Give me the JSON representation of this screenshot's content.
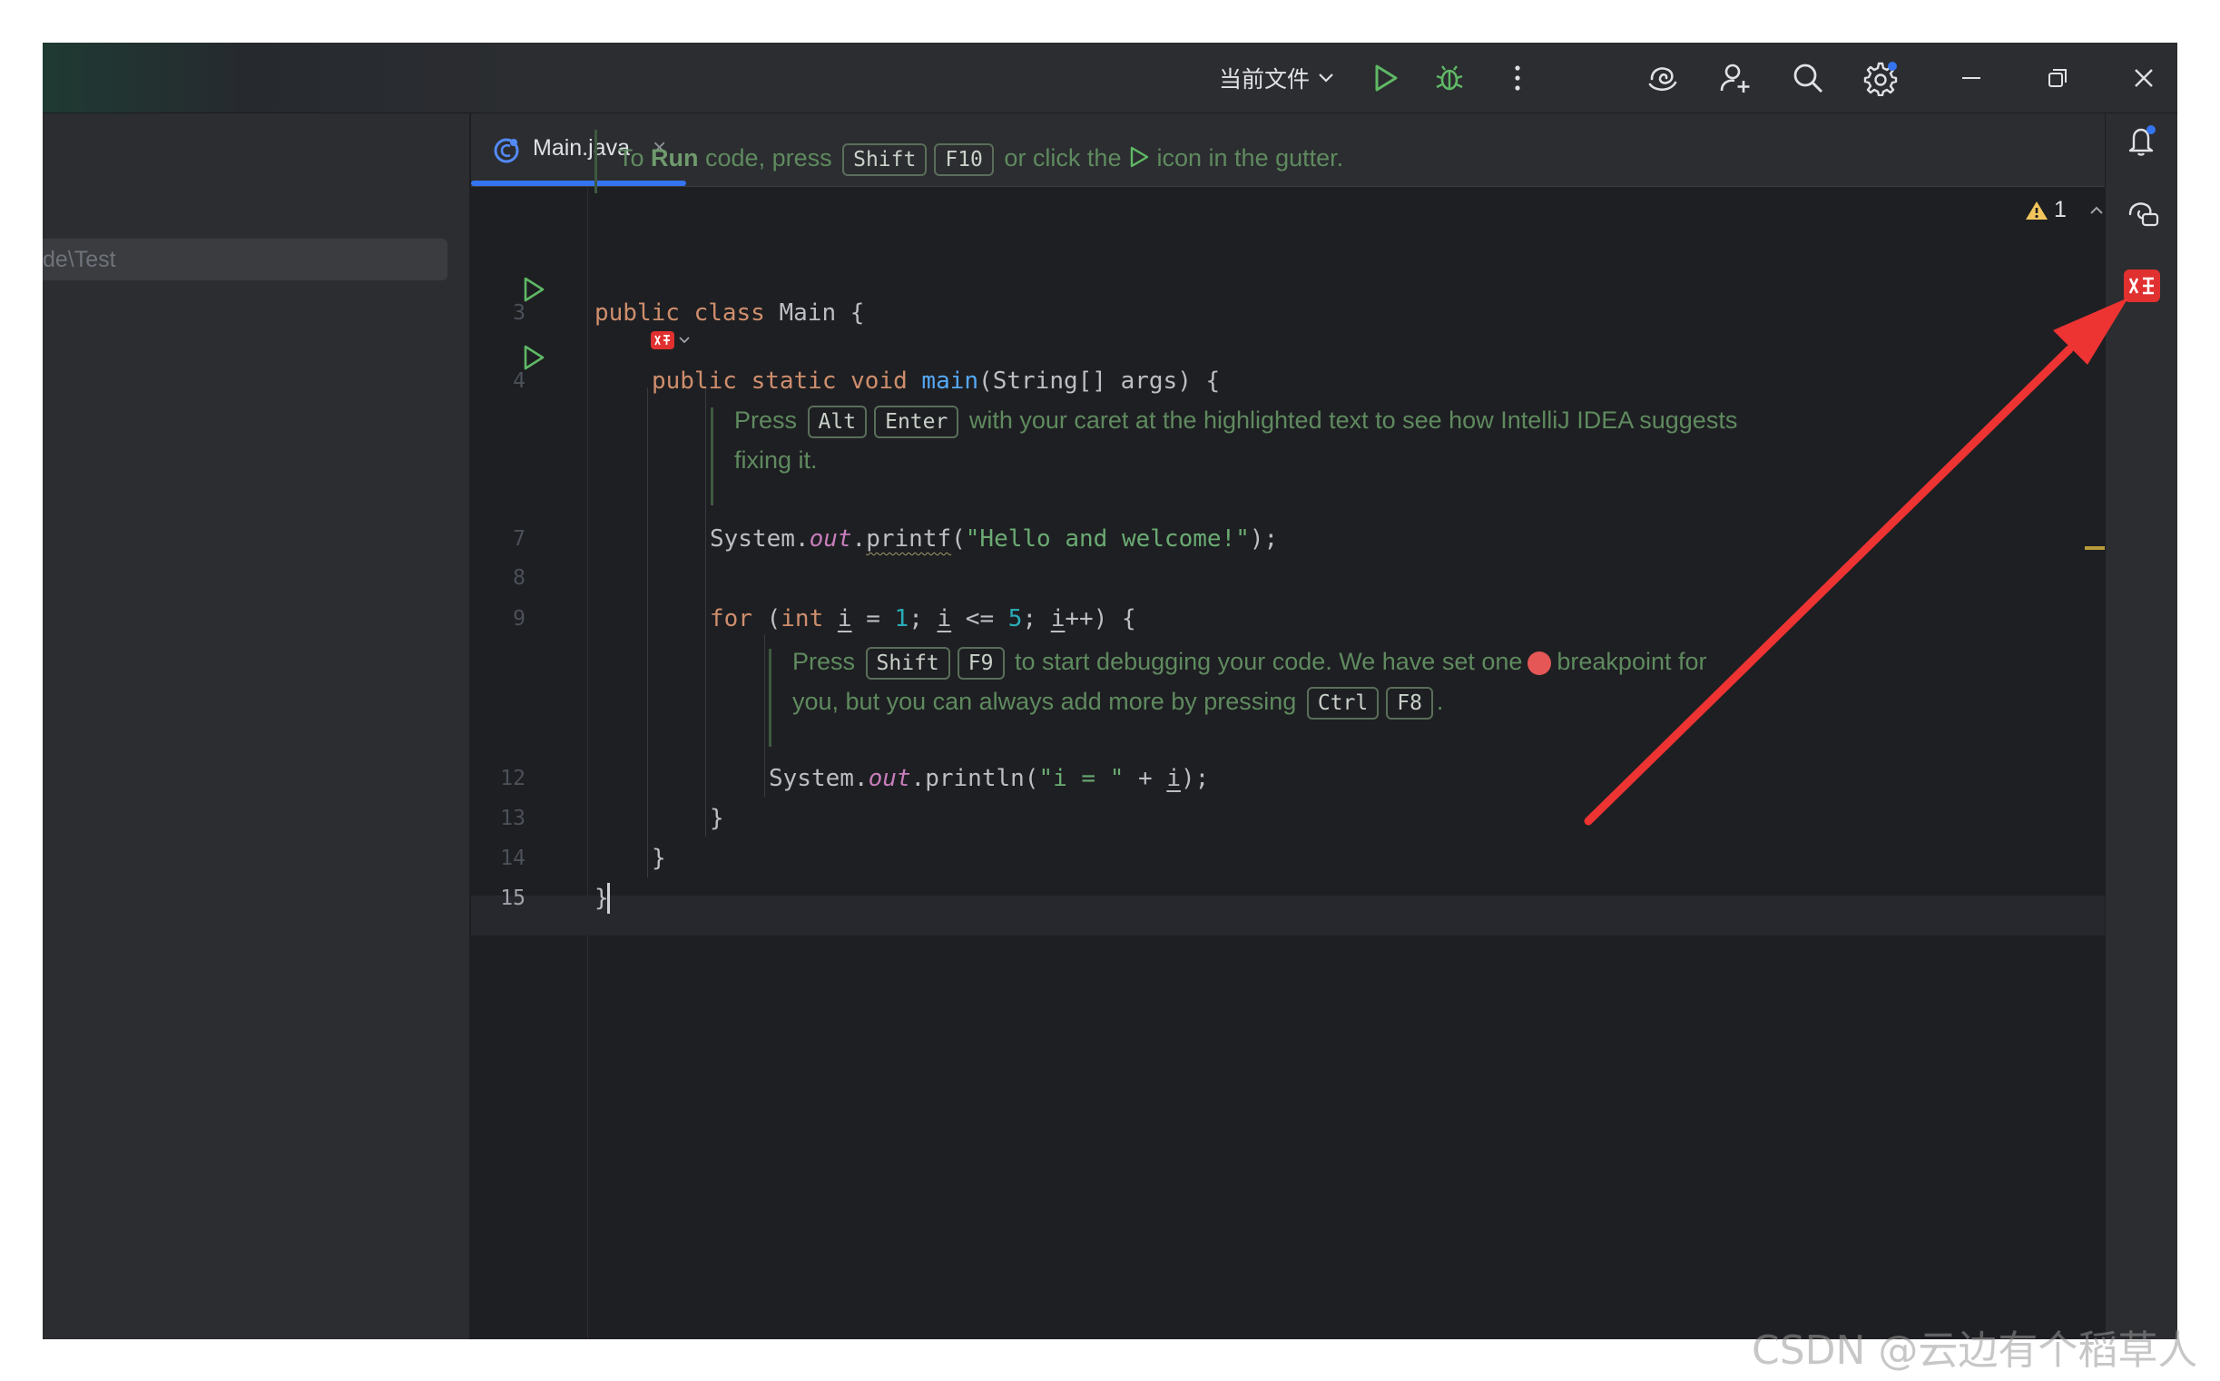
{
  "titlebar": {
    "run_config": "当前文件",
    "icons": [
      "run-icon",
      "debug-icon",
      "more-icon",
      "ai-assistant-icon",
      "add-user-icon",
      "search-icon",
      "settings-icon",
      "minimize-icon",
      "restore-icon",
      "close-icon"
    ]
  },
  "project": {
    "path": "de\\Test"
  },
  "editor": {
    "tab_label": "Main.java",
    "tab_close": "×",
    "warning_count": "1",
    "line_numbers": {
      "l3": "3",
      "l4": "4",
      "l7": "7",
      "l8": "8",
      "l9": "9",
      "l12": "12",
      "l13": "13",
      "l14": "14",
      "l15": "15"
    },
    "hints": {
      "run_prefix": "To ",
      "run_bold": "Run",
      "run_mid": " code, press",
      "run_key1": "Shift",
      "run_key2": "F10",
      "run_mid2": "or click the",
      "run_suffix": "icon in the gutter.",
      "alt_prefix": "Press",
      "alt_key1": "Alt",
      "alt_key2": "Enter",
      "alt_suffix": "with your caret at the highlighted text to see how IntelliJ IDEA suggests",
      "alt_line2": "fixing it.",
      "debug_prefix": "Press",
      "debug_key1": "Shift",
      "debug_key2": "F9",
      "debug_mid": "to start debugging your code. We have set one",
      "debug_suffix": "breakpoint for",
      "debug_line2": "you, but you can always add more by pressing",
      "debug_key3": "Ctrl",
      "debug_key4": "F8",
      "debug_end": "."
    },
    "code": {
      "l3_kw": "public class",
      "l3_rest": " Main {",
      "l4_kw": "public static void",
      "l4_fn": "main",
      "l4_rest": "(String[] args) {",
      "l7_a": "System.",
      "l7_field": "out",
      "l7_dot": ".",
      "l7_fn": "printf",
      "l7_paren": "(",
      "l7_str": "\"Hello and welcome!\"",
      "l7_end": ");",
      "l9_kw": "for",
      "l9_a": " (",
      "l9_int": "int",
      "l9_i1": "i",
      "l9_b": " = ",
      "l9_n1": "1",
      "l9_c": "; ",
      "l9_i2": "i",
      "l9_d": " <= ",
      "l9_n2": "5",
      "l9_e": "; ",
      "l9_i3": "i",
      "l9_f": "++) {",
      "l12_a": "System.",
      "l12_field": "out",
      "l12_b": ".println(",
      "l12_str": "\"i = \"",
      "l12_c": " + ",
      "l12_i": "i",
      "l12_d": ");",
      "l13": "}",
      "l14": "}",
      "l15": "}"
    }
  },
  "right_toolbar": {
    "icons": [
      "notifications-icon",
      "ai-chat-icon",
      "translate-plugin-icon"
    ]
  },
  "colors": {
    "accent": "#3574f0",
    "run_green": "#5fb865",
    "annotation_red": "#ee3333"
  },
  "watermark": "CSDN @云边有个稻草人"
}
